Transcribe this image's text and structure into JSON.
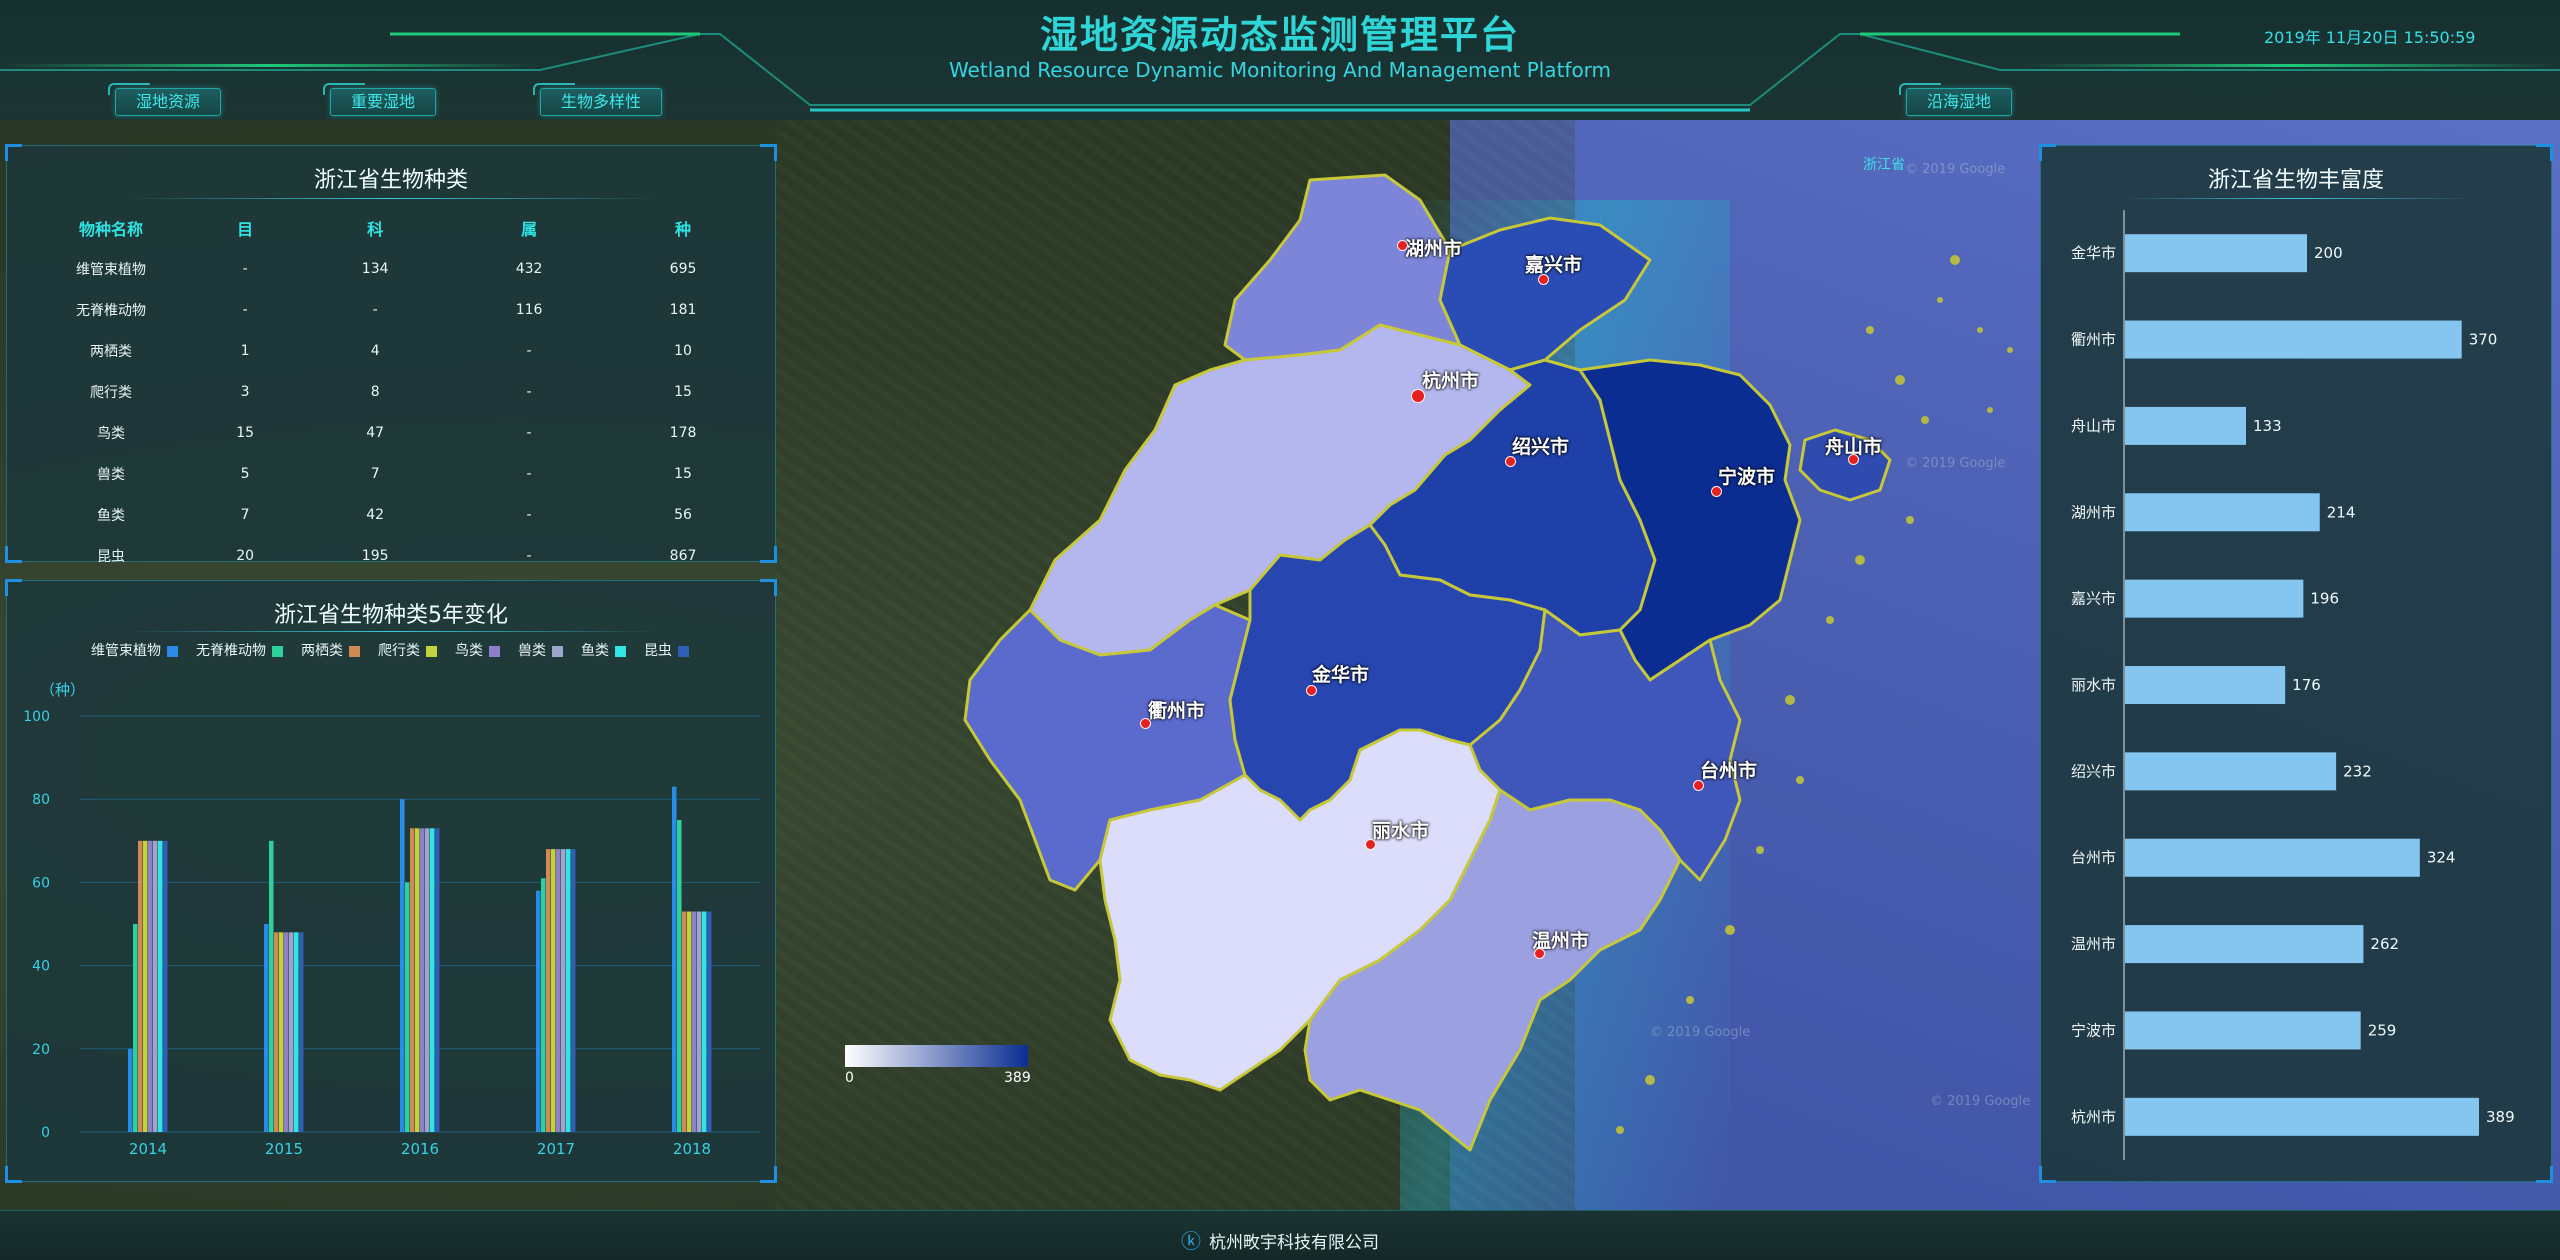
{
  "header": {
    "title_cn": "湿地资源动态监测管理平台",
    "title_en": "Wetland Resource Dynamic Monitoring And Management Platform",
    "datetime": "2019年 11月20日 15:50:59"
  },
  "nav": {
    "wetland_resources": "湿地资源",
    "important_wetlands": "重要湿地",
    "biodiversity": "生物多样性",
    "coastal_wetlands": "沿海湿地"
  },
  "species_table": {
    "title": "浙江省生物种类",
    "headers": [
      "物种名称",
      "目",
      "科",
      "属",
      "种"
    ],
    "rows": [
      [
        "维管束植物",
        "-",
        "134",
        "432",
        "695"
      ],
      [
        "无脊椎动物",
        "-",
        "-",
        "116",
        "181"
      ],
      [
        "两栖类",
        "1",
        "4",
        "-",
        "10"
      ],
      [
        "爬行类",
        "3",
        "8",
        "-",
        "15"
      ],
      [
        "鸟类",
        "15",
        "47",
        "-",
        "178"
      ],
      [
        "兽类",
        "5",
        "7",
        "-",
        "15"
      ],
      [
        "鱼类",
        "7",
        "42",
        "-",
        "56"
      ],
      [
        "昆虫",
        "20",
        "195",
        "-",
        "867"
      ]
    ]
  },
  "chart_data": [
    {
      "type": "bar",
      "title": "浙江省生物种类5年变化",
      "ylabel": "（种）",
      "ylim": [
        0,
        100
      ],
      "yticks": [
        "100",
        "80",
        "60",
        "40",
        "20",
        "0"
      ],
      "categories": [
        "2014",
        "2015",
        "2016",
        "2017",
        "2018"
      ],
      "legend_position": "top",
      "series": [
        {
          "name": "维管束植物",
          "color": "#2a8be8",
          "values": [
            20,
            50,
            80,
            58,
            83
          ]
        },
        {
          "name": "无脊椎动物",
          "color": "#2ed19a",
          "values": [
            50,
            70,
            60,
            61,
            75
          ]
        },
        {
          "name": "两栖类",
          "color": "#d08a55",
          "values": [
            70,
            48,
            73,
            68,
            53
          ]
        },
        {
          "name": "爬行类",
          "color": "#c6d23c",
          "values": [
            70,
            48,
            73,
            68,
            53
          ]
        },
        {
          "name": "鸟类",
          "color": "#8f7fc8",
          "values": [
            70,
            48,
            73,
            68,
            53
          ]
        },
        {
          "name": "兽类",
          "color": "#9aa6cc",
          "values": [
            70,
            48,
            73,
            68,
            53
          ]
        },
        {
          "name": "鱼类",
          "color": "#33e6e6",
          "values": [
            70,
            48,
            73,
            68,
            53
          ]
        },
        {
          "name": "昆虫",
          "color": "#2f5fb4",
          "values": [
            70,
            48,
            73,
            68,
            53
          ]
        }
      ]
    },
    {
      "type": "bar",
      "orientation": "horizontal",
      "title": "浙江省生物丰富度",
      "categories": [
        "金华市",
        "衢州市",
        "舟山市",
        "湖州市",
        "嘉兴市",
        "丽水市",
        "绍兴市",
        "台州市",
        "温州市",
        "宁波市",
        "杭州市"
      ],
      "values": [
        200,
        370,
        133,
        214,
        196,
        176,
        232,
        324,
        262,
        259,
        389
      ],
      "bar_color": "#85c6f0",
      "xlim": [
        0,
        400
      ]
    }
  ],
  "map": {
    "province_label": "浙江省",
    "legend_min": "0",
    "legend_max": "389",
    "watermarks": [
      "© 2019 Google",
      "© 2019 Google",
      "© 2019 Google",
      "© 2019 Google"
    ],
    "cities": [
      {
        "name": "湖州市",
        "color": "#7d85d8"
      },
      {
        "name": "嘉兴市",
        "color": "#2a4cb5"
      },
      {
        "name": "杭州市",
        "color": "#b3b7ee"
      },
      {
        "name": "绍兴市",
        "color": "#1e40a8"
      },
      {
        "name": "宁波市",
        "color": "#0b2d92"
      },
      {
        "name": "舟山市",
        "color": "#2f4bb0"
      },
      {
        "name": "衢州市",
        "color": "#5a6acd"
      },
      {
        "name": "金华市",
        "color": "#2746b0"
      },
      {
        "name": "台州市",
        "color": "#3f56bb"
      },
      {
        "name": "丽水市",
        "color": "#dcdcfb"
      },
      {
        "name": "温州市",
        "color": "#9aa0e0"
      }
    ]
  },
  "footer": {
    "company": "杭州畋宇科技有限公司"
  }
}
